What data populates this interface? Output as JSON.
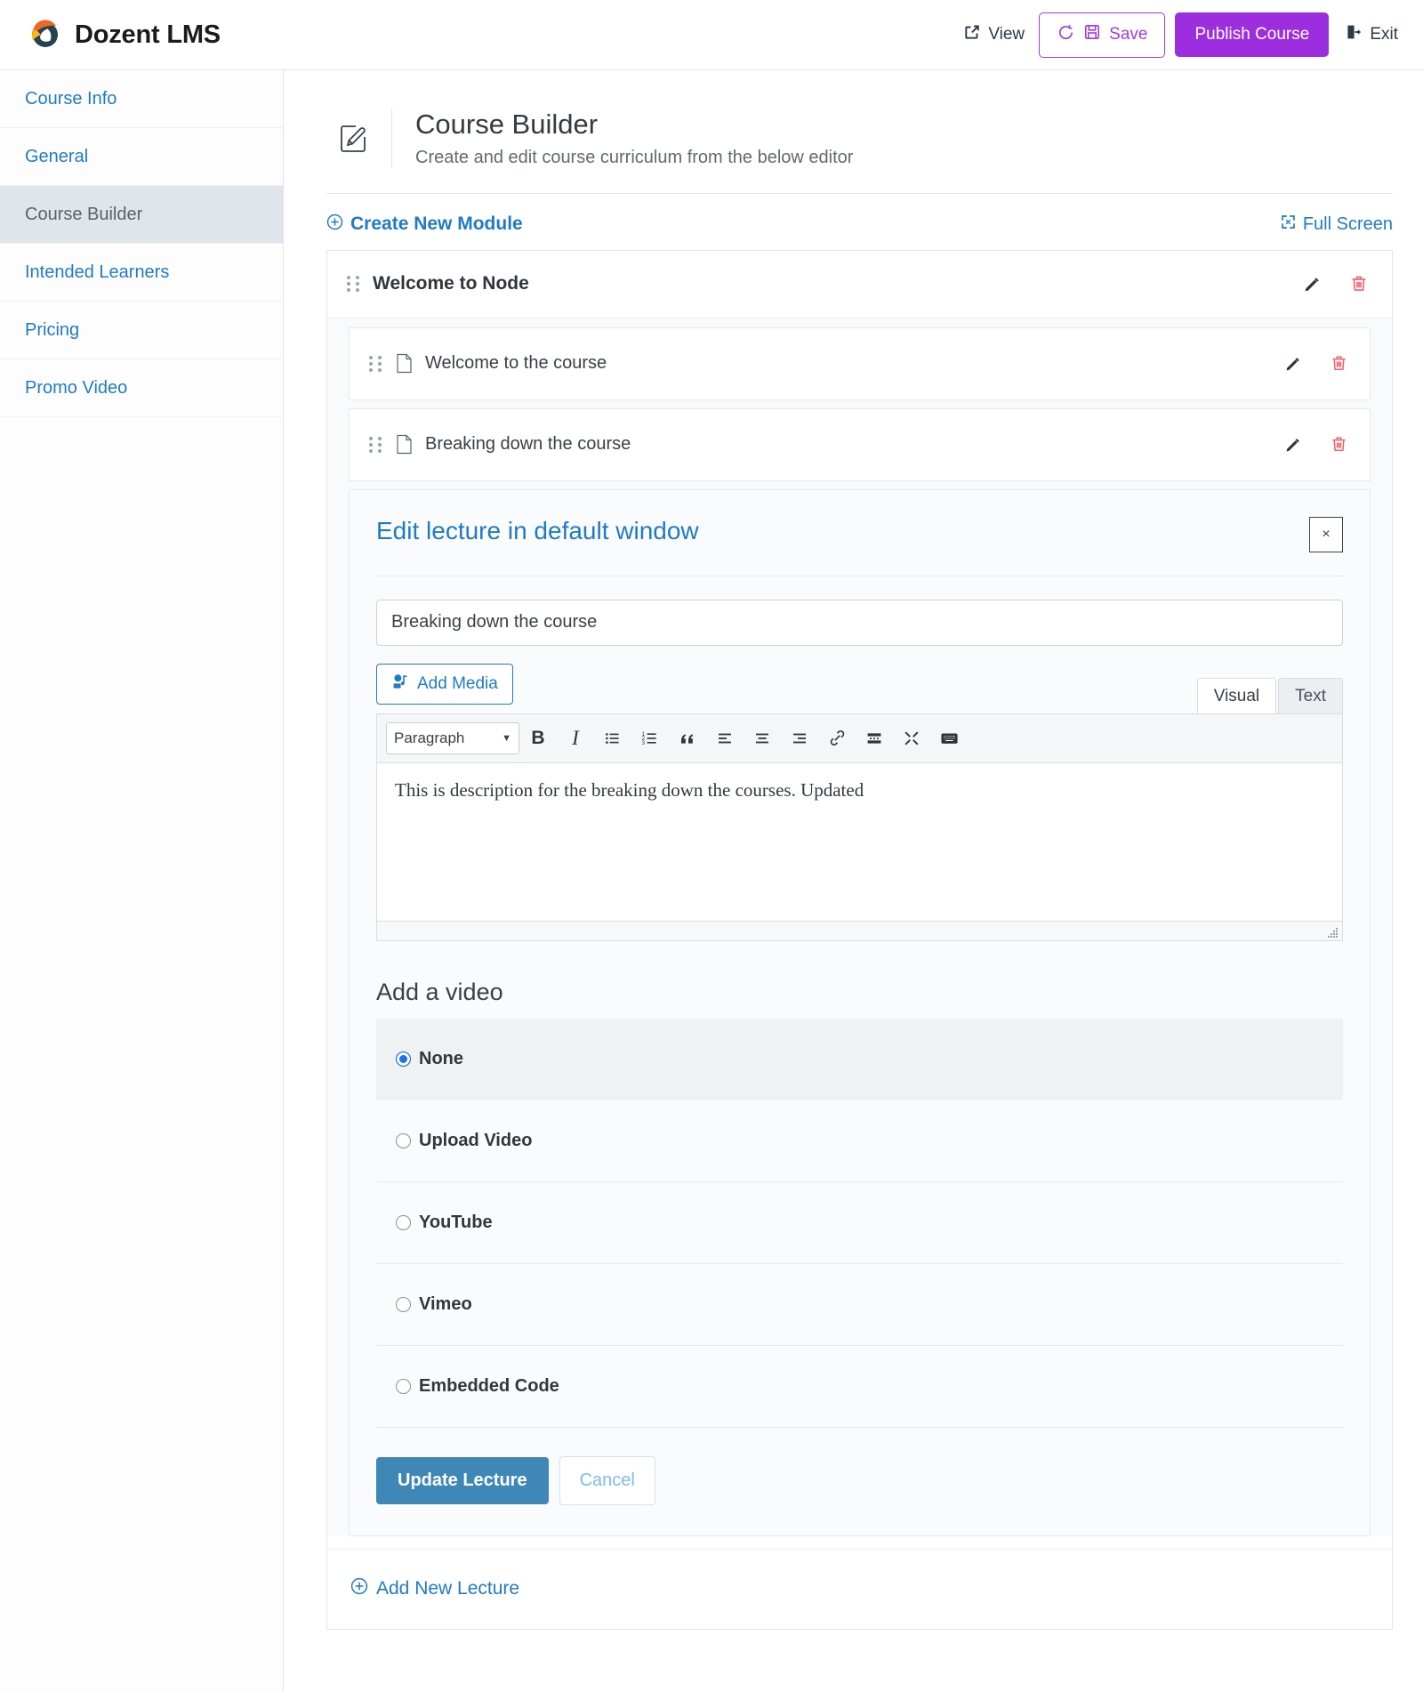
{
  "header": {
    "brand": "Dozent LMS",
    "view_label": "View",
    "save_label": "Save",
    "publish_label": "Publish Course",
    "exit_label": "Exit",
    "accent_purple": "#9d2ee0",
    "link_blue": "#1f7bc4"
  },
  "sidebar": {
    "items": [
      {
        "label": "Course Info",
        "active": false
      },
      {
        "label": "General",
        "active": false
      },
      {
        "label": "Course Builder",
        "active": true
      },
      {
        "label": "Intended Learners",
        "active": false
      },
      {
        "label": "Pricing",
        "active": false
      },
      {
        "label": "Promo Video",
        "active": false
      }
    ]
  },
  "page": {
    "title": "Course Builder",
    "subtitle": "Create and edit course curriculum from the below editor",
    "create_module_label": "Create New Module",
    "full_screen_label": "Full Screen"
  },
  "module": {
    "title": "Welcome to Node",
    "lectures": [
      {
        "title": "Welcome to the course"
      },
      {
        "title": "Breaking down the course"
      }
    ],
    "add_new_lecture_label": "Add New Lecture"
  },
  "editor_panel": {
    "title": "Edit lecture in default window",
    "close_label": "×",
    "lecture_title_value": "Breaking down the course",
    "lecture_title_placeholder": "Lecture name",
    "add_media_label": "Add Media",
    "tabs": [
      {
        "label": "Visual",
        "active": true
      },
      {
        "label": "Text",
        "active": false
      }
    ],
    "toolbar": {
      "block_format": "Paragraph",
      "buttons": [
        {
          "name": "bold",
          "glyph": "B"
        },
        {
          "name": "italic",
          "glyph": "I"
        },
        {
          "name": "bulleted-list",
          "glyph": ""
        },
        {
          "name": "numbered-list",
          "glyph": ""
        },
        {
          "name": "blockquote",
          "glyph": "“"
        },
        {
          "name": "align-left",
          "glyph": ""
        },
        {
          "name": "align-center",
          "glyph": ""
        },
        {
          "name": "align-right",
          "glyph": ""
        },
        {
          "name": "insert-link",
          "glyph": ""
        },
        {
          "name": "insert-read-more",
          "glyph": ""
        },
        {
          "name": "distraction-free",
          "glyph": ""
        },
        {
          "name": "keyboard-shortcuts",
          "glyph": ""
        }
      ]
    },
    "body_text": "This is description for the breaking down the courses. Updated",
    "video": {
      "heading": "Add a video",
      "options": [
        {
          "label": "None",
          "selected": true
        },
        {
          "label": "Upload Video",
          "selected": false
        },
        {
          "label": "YouTube",
          "selected": false
        },
        {
          "label": "Vimeo",
          "selected": false
        },
        {
          "label": "Embedded Code",
          "selected": false
        }
      ]
    },
    "update_label": "Update Lecture",
    "cancel_label": "Cancel"
  }
}
